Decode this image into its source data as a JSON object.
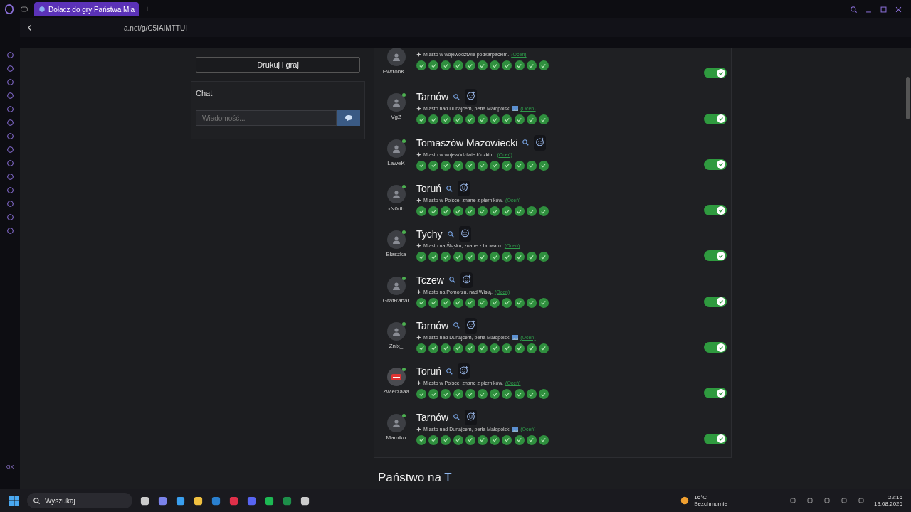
{
  "browser": {
    "tab_title": "Dołacz do gry Państwa Mia",
    "new_tab": "+",
    "address": "a.net/g/C5IAIMTTUI",
    "sidebar_footer": "GX"
  },
  "left_panel": {
    "print_button": "Drukuj i graj",
    "chat": {
      "title": "Chat",
      "placeholder": "Wiadomość..."
    }
  },
  "answers": [
    {
      "user": "EwrronK...",
      "custom_avatar": false,
      "online": false,
      "description": "Miasto w województwie podkarpackim.",
      "has_image": false,
      "rate_link": "(Oceń)",
      "checks": [
        true,
        true,
        true,
        true,
        true,
        true,
        true,
        true,
        true,
        true,
        true
      ],
      "accepted": true
    },
    {
      "user": "VgZ",
      "custom_avatar": false,
      "online": true,
      "title": "Tarnów",
      "description": "Miasto nad Dunajcem, perła Małopolski",
      "has_image": true,
      "rate_link": "(Oceń)",
      "checks": [
        true,
        true,
        true,
        true,
        true,
        true,
        true,
        true,
        true,
        true,
        true
      ],
      "accepted": true
    },
    {
      "user": "LaweK",
      "custom_avatar": false,
      "online": true,
      "title": "Tomaszów Mazowiecki",
      "description": "Miasto w województwie łódzkim.",
      "has_image": false,
      "rate_link": "(Oceń)",
      "checks": [
        true,
        true,
        true,
        true,
        true,
        true,
        true,
        true,
        true,
        true,
        true
      ],
      "accepted": true
    },
    {
      "user": "xN0rth",
      "custom_avatar": false,
      "online": true,
      "title": "Toruń",
      "description": "Miasto w Polsce, znane z pierników.",
      "has_image": false,
      "rate_link": "(Oceń)",
      "checks": [
        true,
        true,
        true,
        true,
        true,
        true,
        true,
        true,
        true,
        true,
        true
      ],
      "accepted": true
    },
    {
      "user": "Blaszka",
      "custom_avatar": false,
      "online": true,
      "title": "Tychy",
      "description": "Miasto na Śląsku, znane z browaru.",
      "has_image": false,
      "rate_link": "(Oceń)",
      "checks": [
        true,
        true,
        true,
        true,
        true,
        true,
        true,
        true,
        true,
        true,
        true
      ],
      "accepted": true
    },
    {
      "user": "GrafRabar",
      "custom_avatar": false,
      "online": true,
      "title": "Tczew",
      "description": "Miasto na Pomorzu, nad Wisłą.",
      "has_image": false,
      "rate_link": "(Oceń)",
      "checks": [
        true,
        true,
        true,
        true,
        true,
        true,
        true,
        true,
        true,
        true,
        true
      ],
      "accepted": true
    },
    {
      "user": "Znix_",
      "custom_avatar": false,
      "online": true,
      "title": "Tarnów",
      "description": "Miasto nad Dunajcem, perła Małopolski",
      "has_image": true,
      "rate_link": "(Oceń)",
      "checks": [
        true,
        true,
        true,
        true,
        true,
        true,
        true,
        true,
        true,
        true,
        true
      ],
      "accepted": true
    },
    {
      "user": "Zwierzaaa",
      "custom_avatar": true,
      "online": true,
      "title": "Toruń",
      "description": "Miasto w Polsce, znane z pierników.",
      "has_image": false,
      "rate_link": "(Oceń)",
      "checks": [
        true,
        true,
        true,
        true,
        true,
        true,
        true,
        true,
        true,
        true,
        true
      ],
      "accepted": true
    },
    {
      "user": "Mamiko",
      "custom_avatar": false,
      "online": true,
      "title": "Tarnów",
      "description": "Miasto nad Dunajcem, perła Małopolski",
      "has_image": true,
      "rate_link": "(Oceń)",
      "checks": [
        true,
        true,
        true,
        true,
        true,
        true,
        true,
        true,
        true,
        true,
        true
      ],
      "accepted": true
    }
  ],
  "next_section": {
    "title_prefix": "Państwo na ",
    "letter": "T"
  },
  "taskbar": {
    "search_placeholder": "Wyszukaj",
    "temperature": "16°C",
    "weather": "Bezchmurnie",
    "time": "22:16",
    "date": "13.08.2026"
  }
}
